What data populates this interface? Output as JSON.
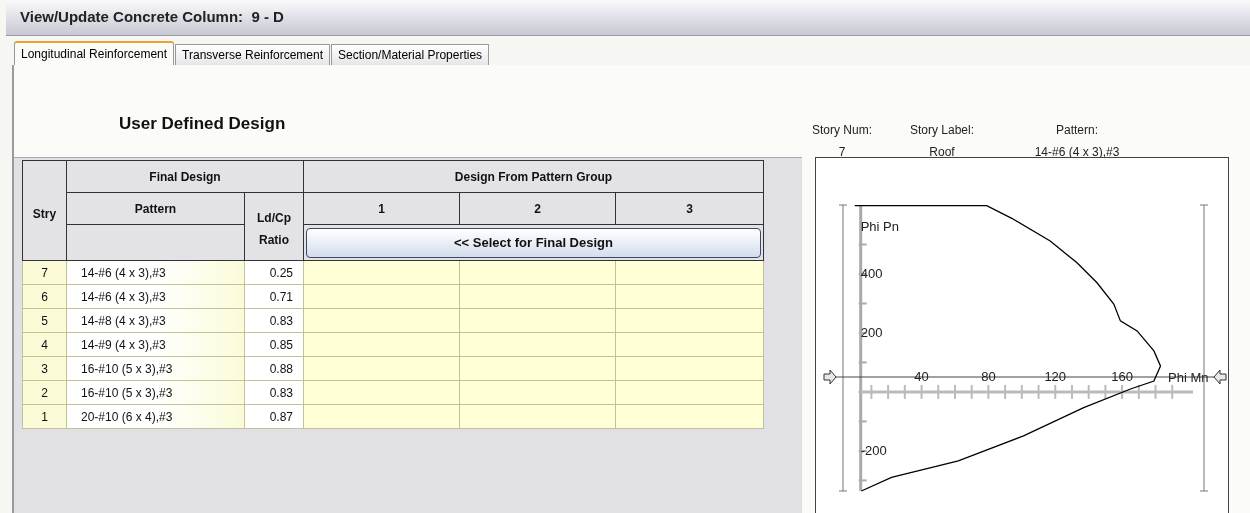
{
  "window": {
    "title": "View/Update Concrete Column:  9 - D"
  },
  "tabs": [
    {
      "label": "Longitudinal Reinforcement",
      "selected": true
    },
    {
      "label": "Transverse Reinforcement",
      "selected": false
    },
    {
      "label": "Section/Material Properties",
      "selected": false
    }
  ],
  "heading": "User Defined Design",
  "story_info": [
    {
      "label": "Story Num:",
      "value": "7"
    },
    {
      "label": "Story Label:",
      "value": "Roof"
    },
    {
      "label": "Pattern:",
      "value": "14-#6 (4 x 3),#3"
    }
  ],
  "table": {
    "stry_header": "Stry",
    "final_design_header": "Final Design",
    "pattern_header": "Pattern",
    "ratio_header": "Ld/Cp Ratio",
    "group_header": "Design From Pattern Group",
    "group_columns": [
      "1",
      "2",
      "3"
    ],
    "select_button": "<< Select for Final Design",
    "rows": [
      {
        "stry": "7",
        "pattern": "14-#6 (4 x 3),#3",
        "ratio": "0.25"
      },
      {
        "stry": "6",
        "pattern": "14-#6 (4 x 3),#3",
        "ratio": "0.71"
      },
      {
        "stry": "5",
        "pattern": "14-#8 (4 x 3),#3",
        "ratio": "0.83"
      },
      {
        "stry": "4",
        "pattern": "14-#9 (4 x 3),#3",
        "ratio": "0.85"
      },
      {
        "stry": "3",
        "pattern": "16-#10 (5 x 3),#3",
        "ratio": "0.88"
      },
      {
        "stry": "2",
        "pattern": "16-#10 (5 x 3),#3",
        "ratio": "0.83"
      },
      {
        "stry": "1",
        "pattern": "20-#10 (6 x 4),#3",
        "ratio": "0.87"
      }
    ]
  },
  "chart": {
    "chart_data": {
      "type": "line",
      "xlabel": "Phi Mn",
      "ylabel": "Phi Pn",
      "x": [
        0,
        79,
        94,
        117,
        133,
        145,
        155,
        159,
        169,
        179,
        183,
        179,
        165,
        137,
        101,
        62,
        22,
        4
      ],
      "series": [
        {
          "color": "#000000",
          "values": [
            632,
            632,
            589,
            512,
            438,
            370,
            298,
            241,
            207,
            139,
            88,
            37,
            10,
            -53,
            -149,
            -234,
            -290,
            -336
          ]
        }
      ],
      "xlim": [
        -7,
        209
      ],
      "ylim": [
        -336,
        634
      ],
      "xticks": [
        40,
        80,
        120,
        160
      ],
      "yticks": [
        -200,
        200,
        400
      ]
    }
  }
}
